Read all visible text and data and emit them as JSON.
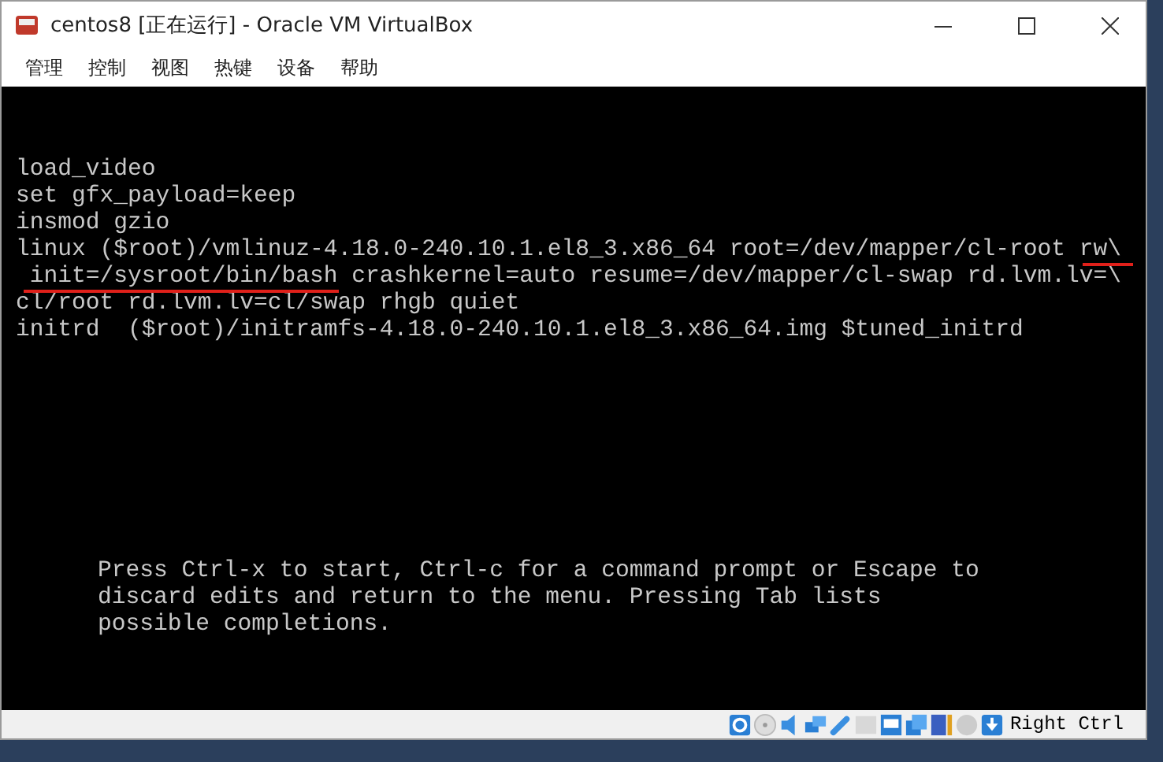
{
  "window": {
    "title": "centos8 [正在运行] - Oracle VM VirtualBox"
  },
  "menu": [
    "管理",
    "控制",
    "视图",
    "热键",
    "设备",
    "帮助"
  ],
  "terminal": {
    "lines": [
      "load_video",
      "set gfx_payload=keep",
      "insmod gzio",
      "linux ($root)/vmlinuz-4.18.0-240.10.1.el8_3.x86_64 root=/dev/mapper/cl-root rw\\",
      " init=/sysroot/bin/bash crashkernel=auto resume=/dev/mapper/cl-swap rd.lvm.lv=\\",
      "cl/root rd.lvm.lv=cl/swap rhgb quiet",
      "initrd  ($root)/initramfs-4.18.0-240.10.1.el8_3.x86_64.img $tuned_initrd"
    ],
    "help": [
      "Press Ctrl-x to start, Ctrl-c for a command prompt or Escape to",
      "discard edits and return to the menu. Pressing Tab lists",
      "possible completions."
    ]
  },
  "status_bar": {
    "host_key": "Right Ctrl"
  }
}
